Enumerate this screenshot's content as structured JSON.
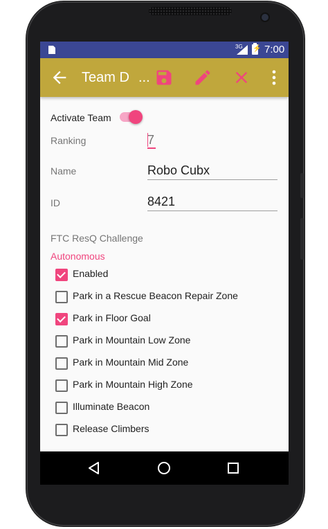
{
  "status_bar": {
    "network": "3G",
    "time": "7:00",
    "icons": [
      "sim-card-icon",
      "signal-icon",
      "battery-charging-icon"
    ]
  },
  "app_bar": {
    "title": "Team D",
    "title_ellipsis": "...",
    "color": "#c0a73c",
    "actions": [
      "save-icon",
      "edit-icon",
      "close-icon",
      "more-vert-icon"
    ]
  },
  "form": {
    "activate_team_label": "Activate Team",
    "activate_team_on": true,
    "ranking_label": "Ranking",
    "ranking_value": "7",
    "name_label": "Name",
    "name_value": "Robo Cubx",
    "id_label": "ID",
    "id_value": "8421"
  },
  "challenge": {
    "title": "FTC ResQ Challenge",
    "section": "Autonomous",
    "items": [
      {
        "label": "Enabled",
        "checked": true
      },
      {
        "label": "Park in a Rescue Beacon Repair Zone",
        "checked": false
      },
      {
        "label": "Park in Floor Goal",
        "checked": true
      },
      {
        "label": "Park in Mountain Low Zone",
        "checked": false
      },
      {
        "label": "Park in Mountain Mid Zone",
        "checked": false
      },
      {
        "label": "Park in Mountain High Zone",
        "checked": false
      },
      {
        "label": "Illuminate Beacon",
        "checked": false
      },
      {
        "label": "Release Climbers",
        "checked": false
      }
    ]
  },
  "nav_bar": {
    "buttons": [
      "back-triangle-icon",
      "home-circle-icon",
      "recents-square-icon"
    ]
  },
  "colors": {
    "accent": "#f0457e",
    "status_bar": "#3b4794",
    "app_bar": "#c0a73c"
  }
}
